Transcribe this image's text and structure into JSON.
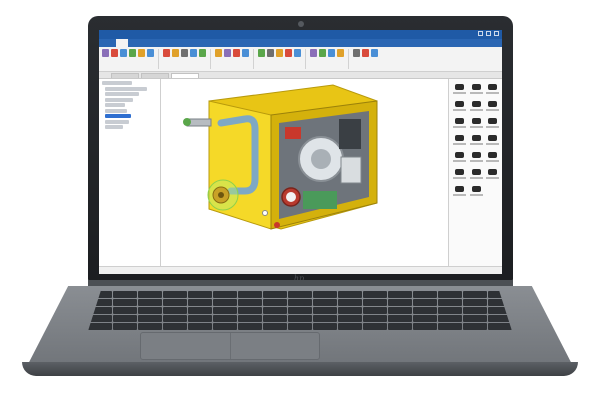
{
  "device": {
    "type": "laptop",
    "bezel_logo_icon": "hp-logo-icon"
  },
  "app": {
    "ribbon_active_tab_index": 1,
    "tree_selected_index": 6,
    "active_document_tab_index": 2
  },
  "colors": {
    "ribbon_blue": "#2a66b3",
    "housing_yellow": "#f2d31b",
    "handle_blue": "#7ea8c4",
    "selection_green": "#b7f070"
  }
}
